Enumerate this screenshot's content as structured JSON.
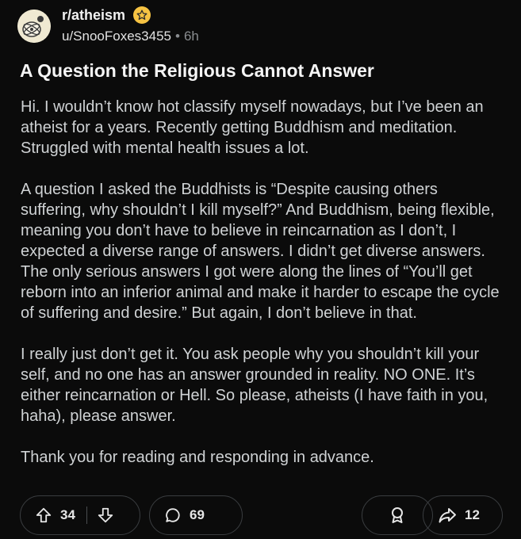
{
  "post": {
    "subreddit": "r/atheism",
    "username": "u/SnooFoxes3455",
    "separator": "•",
    "age": "6h",
    "title": "A Question the Religious Cannot Answer",
    "paragraphs": [
      "Hi. I wouldn’t know hot classify myself nowadays, but I’ve been an atheist for a years. Recently getting Buddhism and meditation. Struggled with mental health issues a lot.",
      "A question I asked the Buddhists is “Despite causing others suffering, why shouldn’t I kill myself?” And Buddhism, being flexible, meaning you don’t have to believe in reincarnation as I don’t, I expected a diverse range of answers. I didn’t get diverse answers. The only serious answers I got were along the lines of “You’ll get reborn into an inferior animal and make it harder to escape the cycle of suffering and desire.” But again, I don’t believe in that.",
      "I really just don’t get it. You ask people why you shouldn’t kill your self, and no one has an answer grounded in reality. NO ONE. It’s either reincarnation or Hell. So please, atheists (I have faith in you, haha), please answer.",
      "Thank you for reading and responding in advance."
    ]
  },
  "actions": {
    "upvotes": "34",
    "comments": "69",
    "shares": "12"
  },
  "icons": {
    "subreddit_avatar": "atheism-atom-avatar-icon",
    "badge": "star-badge-icon",
    "upvote": "arrow-up-icon",
    "downvote": "arrow-down-icon",
    "comment": "speech-bubble-icon",
    "award": "award-icon",
    "share": "share-arrow-icon"
  },
  "colors": {
    "background": "#0b0b0b",
    "badge": "#f6c343",
    "border": "#3a3d40"
  }
}
